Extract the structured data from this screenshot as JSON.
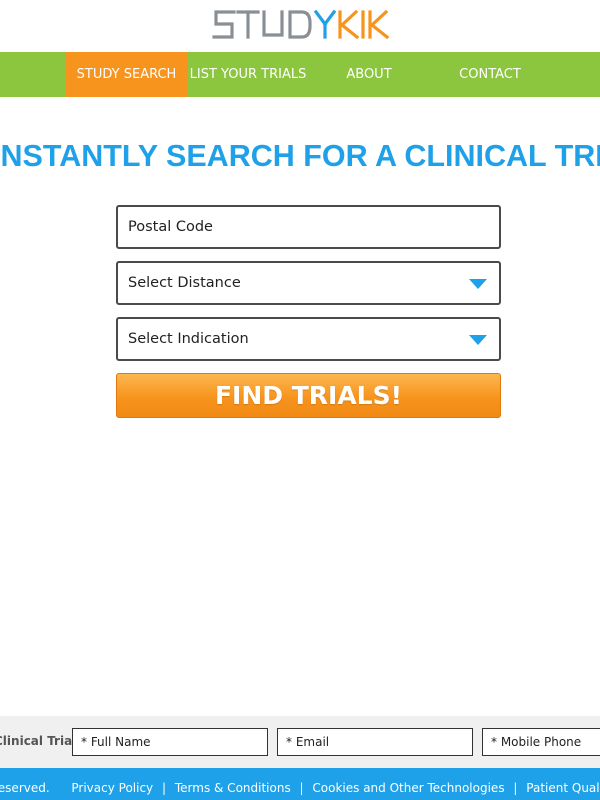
{
  "brand": {
    "logo_text": "STUDYKIK",
    "colors": {
      "gray": "#8a8f96",
      "orange": "#f7941d",
      "blue": "#1ea1e8",
      "green": "#8cc63f"
    }
  },
  "nav": {
    "items": [
      {
        "label": "STUDY SEARCH",
        "active": true
      },
      {
        "label": "LIST YOUR TRIALS",
        "active": false
      },
      {
        "label": "ABOUT",
        "active": false
      },
      {
        "label": "CONTACT",
        "active": false
      }
    ]
  },
  "hero": {
    "headline": "INSTANTLY SEARCH FOR A CLINICAL TRIAL"
  },
  "search_form": {
    "postal_placeholder": "Postal Code",
    "distance_label": "Select Distance",
    "indication_label": "Select Indication",
    "submit_label": "FIND TRIALS!"
  },
  "lead_form": {
    "label": "Clinical Trials",
    "full_name_placeholder": "* Full Name",
    "email_placeholder": "* Email",
    "phone_placeholder": "* Mobile Phone"
  },
  "footer": {
    "rights_text": "Reserved.",
    "links": [
      "Privacy Policy",
      "Terms & Conditions",
      "Cookies and Other Technologies",
      "Patient Qualification Suite"
    ],
    "separator": "|"
  }
}
